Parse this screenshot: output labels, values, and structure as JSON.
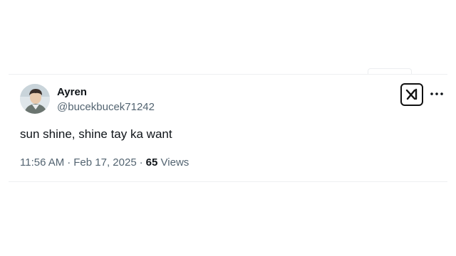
{
  "tweet": {
    "author_name": "Ayren",
    "author_handle": "@bucekbucek71242",
    "text": "sun shine, shine tay ka want",
    "time": "11:56 AM",
    "separator": "·",
    "date": "Feb 17, 2025",
    "views_count": "65",
    "views_label": "Views"
  },
  "icons": {
    "brand_logo": "x-logo-icon",
    "more": "more-horizontal-icon",
    "avatar": "user-avatar"
  },
  "colors": {
    "text_primary": "#0f1419",
    "text_secondary": "#536471",
    "divider": "#eef0f2"
  }
}
